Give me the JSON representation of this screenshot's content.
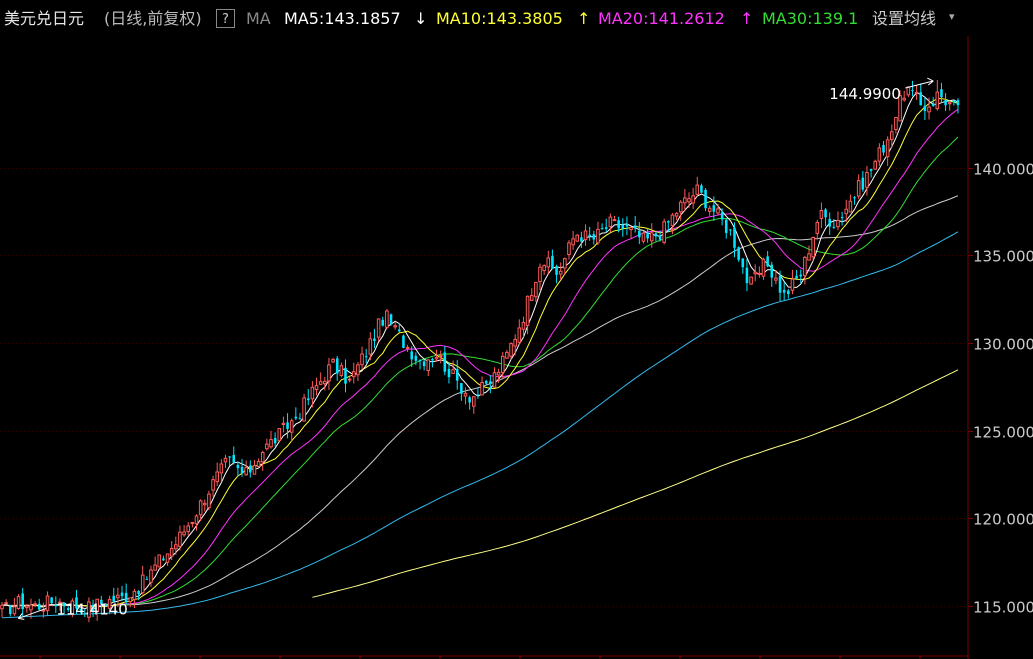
{
  "header": {
    "symbol": "美元兑日元",
    "mode": "(日线,前复权)",
    "help": "?",
    "ma_label": "MA",
    "ma5": "MA5:143.1857",
    "ma5_arrow": "↓",
    "ma10": "MA10:143.3805",
    "ma10_arrow": "↑",
    "ma20": "MA20:141.2612",
    "ma20_arrow": "↑",
    "ma30": "MA30:139.1",
    "settings": "设置均线",
    "settings_caret": "▾"
  },
  "colors": {
    "background": "#000000",
    "up": "#ff5a5a",
    "down": "#00e5ff",
    "ma5": "#ffffff",
    "ma10": "#ffff33",
    "ma20": "#ff33ff",
    "ma30": "#33dd33",
    "ma60": "#cccccc",
    "ma120": "#33bbee",
    "ma250": "#ffff88",
    "grid": "#3a0000",
    "axis_text": "#cccccc"
  },
  "chart_data": {
    "type": "candlestick",
    "ylim": [
      112.5,
      147.5
    ],
    "y_ticks": [
      "115.000",
      "120.000",
      "125.000",
      "130.000",
      "135.000",
      "140.000"
    ],
    "tick_values": [
      115,
      120,
      125,
      130,
      135,
      140
    ],
    "grid": true,
    "annotations": [
      {
        "label": "144.9900",
        "value": 144.99
      },
      {
        "label": "114.4140",
        "value": 114.414
      }
    ],
    "price_path": [
      114.7,
      115.2,
      115.0,
      115.3,
      115.1,
      114.9,
      115.3,
      115.5,
      116.2,
      117.5,
      118.6,
      120.1,
      121.8,
      123.3,
      122.4,
      123.9,
      124.8,
      125.9,
      127.4,
      128.8,
      127.8,
      129.6,
      131.6,
      130.2,
      129.0,
      129.4,
      128.0,
      126.9,
      127.6,
      129.2,
      131.6,
      134.8,
      133.9,
      136.3,
      135.9,
      136.8,
      136.5,
      135.8,
      136.4,
      137.8,
      138.7,
      137.5,
      136.2,
      133.2,
      134.6,
      132.7,
      134.0,
      137.3,
      136.9,
      138.4,
      139.9,
      141.8,
      144.6,
      143.4,
      144.1,
      143.2
    ],
    "ma5": {
      "label": "MA5",
      "value": 143.1857
    },
    "ma10": {
      "label": "MA10",
      "value": 143.3805
    },
    "ma20": {
      "label": "MA20",
      "value": 141.2612
    },
    "ma30": {
      "label": "MA30",
      "value": 139.1
    }
  }
}
